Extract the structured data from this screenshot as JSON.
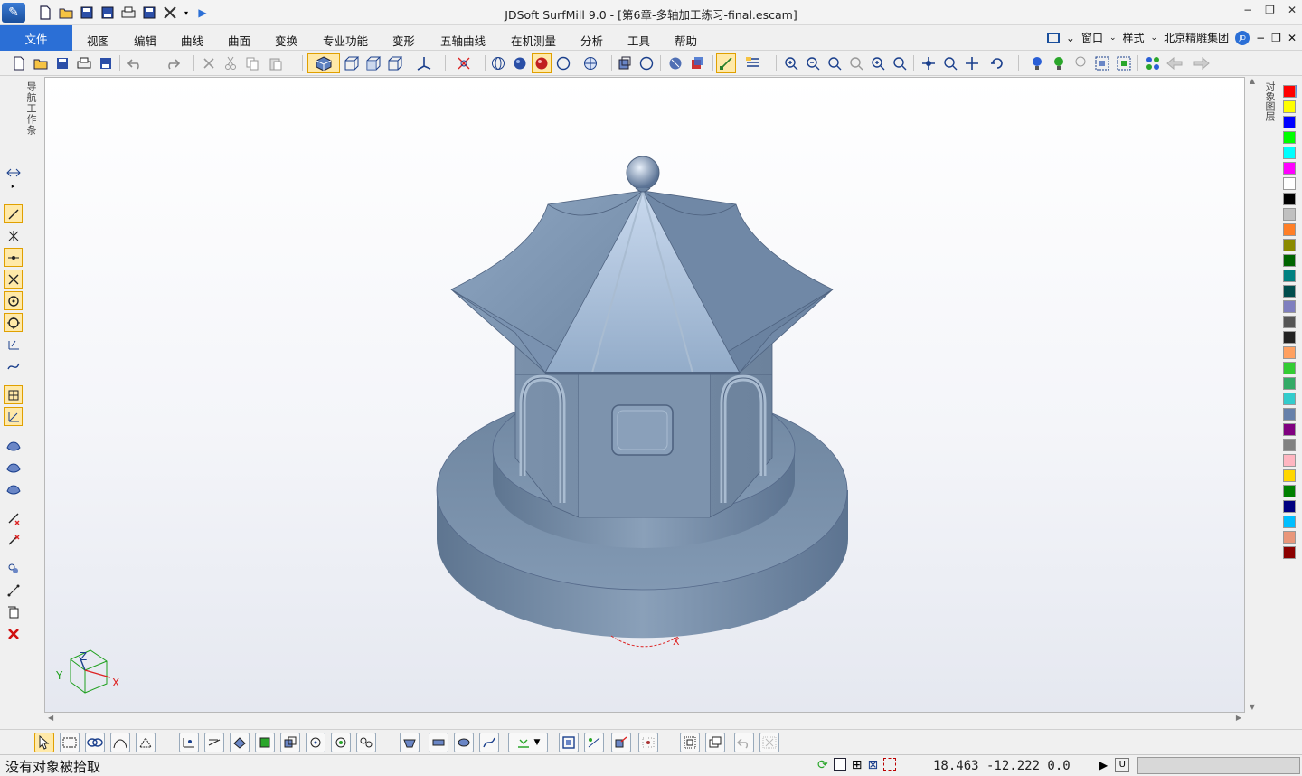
{
  "window": {
    "title": "JDSoft SurfMill 9.0 - [第6章-多轴加工练习-final.escam]",
    "minimize": "−",
    "restore": "❐",
    "close": "✕"
  },
  "menu": {
    "file": "文件",
    "items": [
      "视图",
      "编辑",
      "曲线",
      "曲面",
      "变换",
      "专业功能",
      "变形",
      "五轴曲线",
      "在机测量",
      "分析",
      "工具",
      "帮助"
    ],
    "right": {
      "window_menu": "窗口",
      "style_menu": "样式",
      "company": "北京精雕集团",
      "badge": "JD"
    }
  },
  "left_panel": {
    "nav_label": "导航工作条"
  },
  "right_panel": {
    "layer_label": "对象图层"
  },
  "palette": {
    "colors": [
      "#ff0000",
      "#ffff00",
      "#0000ff",
      "#00ff00",
      "#00ffff",
      "#ff00ff",
      "#ffffff",
      "#000000",
      "#c0c0c0",
      "#ff7f27",
      "#8b8b00",
      "#006400",
      "#008080",
      "#004d4d",
      "#7f7fbf",
      "#555555",
      "#222222",
      "#ffa060",
      "#33cc33",
      "#33aa66",
      "#33cccc",
      "#6680aa",
      "#800080",
      "#808080",
      "#ffb6c1",
      "#ffd700",
      "#008000",
      "#000080",
      "#00bfff",
      "#e9967a",
      "#8b0000"
    ]
  },
  "viewport": {
    "axis": {
      "x": "X",
      "y": "Y",
      "z": "Z"
    },
    "model_color": "#7d93ad"
  },
  "status": {
    "message": "没有对象被拾取",
    "coords": "18.463  -12.222  0.0",
    "mode_button": "U"
  }
}
